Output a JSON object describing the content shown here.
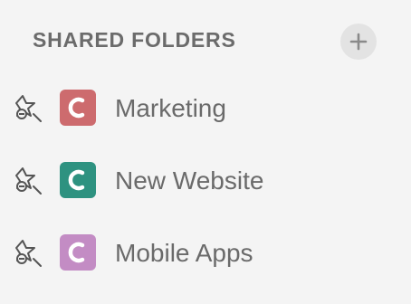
{
  "shared_folders": {
    "title": "SHARED FOLDERS",
    "add_icon": "plus-icon",
    "items": [
      {
        "label": "Marketing",
        "color": "#cd6b6e",
        "icon": "folder-app-c-icon",
        "action_icon": "unpin-icon"
      },
      {
        "label": "New Website",
        "color": "#2e9280",
        "icon": "folder-app-c-icon",
        "action_icon": "unpin-icon"
      },
      {
        "label": "Mobile Apps",
        "color": "#c38cc4",
        "icon": "folder-app-c-icon",
        "action_icon": "unpin-icon"
      }
    ]
  }
}
